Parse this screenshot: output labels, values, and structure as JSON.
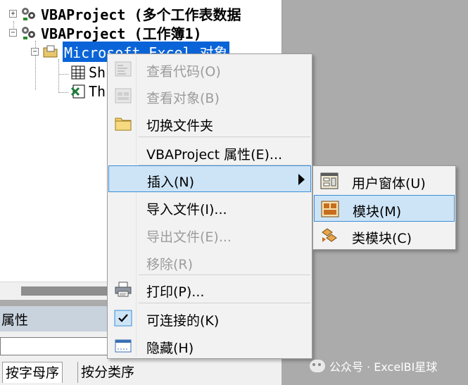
{
  "explorer": {
    "nodes": [
      {
        "label": "VBAProject (多个工作表数据"
      },
      {
        "label": "VBAProject (工作簿1)"
      },
      {
        "label": "Microsoft Excel 对象"
      },
      {
        "label": "Sh"
      },
      {
        "label": "Th"
      }
    ]
  },
  "properties": {
    "title": "属性",
    "tabs": [
      "按字母序",
      "按分类序"
    ]
  },
  "context_menu": {
    "items": [
      {
        "label": "查看代码(O)",
        "disabled": true,
        "icon": "view-code-icon"
      },
      {
        "label": "查看对象(B)",
        "disabled": true,
        "icon": "view-object-icon"
      },
      {
        "label": "切换文件夹",
        "disabled": false,
        "icon": "folder-icon"
      },
      {
        "label": "VBAProject 属性(E)...",
        "disabled": false
      },
      {
        "label": "插入(N)",
        "disabled": false,
        "highlighted": true,
        "has_submenu": true
      },
      {
        "label": "导入文件(I)...",
        "disabled": false
      },
      {
        "label": "导出文件(E)...",
        "disabled": true
      },
      {
        "label": "移除(R)",
        "disabled": true
      },
      {
        "label": "打印(P)...",
        "disabled": false,
        "icon": "printer-icon"
      },
      {
        "label": "可连接的(K)",
        "disabled": false,
        "checked": true,
        "icon": "check-icon"
      },
      {
        "label": "隐藏(H)",
        "disabled": false,
        "icon": "hide-window-icon"
      }
    ]
  },
  "submenu": {
    "items": [
      {
        "label": "用户窗体(U)",
        "icon": "userform-icon"
      },
      {
        "label": "模块(M)",
        "icon": "module-icon",
        "highlighted": true
      },
      {
        "label": "类模块(C)",
        "icon": "class-module-icon"
      }
    ]
  },
  "watermark": {
    "text": "公众号 · ExcelBI星球"
  },
  "colors": {
    "selection_bg": "#0a64d8",
    "menu_highlight": "#cde4f7",
    "menu_highlight_border": "#3c8fd6",
    "disabled_text": "#9c9c9c"
  }
}
